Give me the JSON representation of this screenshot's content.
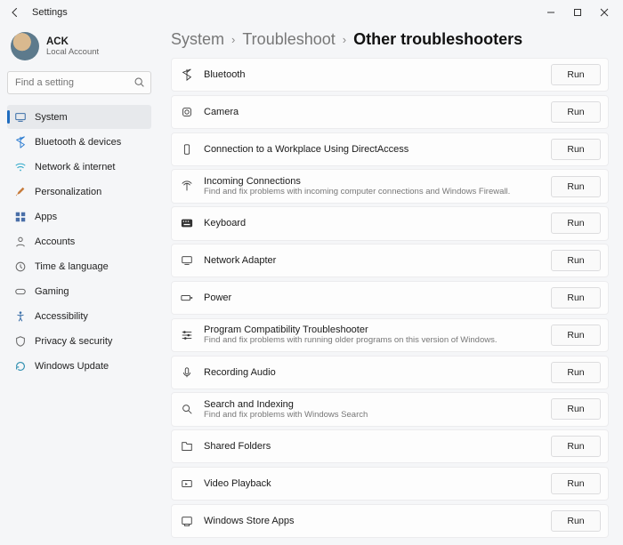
{
  "window": {
    "title": "Settings"
  },
  "user": {
    "name": "ACK",
    "sub": "Local Account"
  },
  "search": {
    "placeholder": "Find a setting"
  },
  "sidebar": {
    "items": [
      {
        "label": "System"
      },
      {
        "label": "Bluetooth & devices"
      },
      {
        "label": "Network & internet"
      },
      {
        "label": "Personalization"
      },
      {
        "label": "Apps"
      },
      {
        "label": "Accounts"
      },
      {
        "label": "Time & language"
      },
      {
        "label": "Gaming"
      },
      {
        "label": "Accessibility"
      },
      {
        "label": "Privacy & security"
      },
      {
        "label": "Windows Update"
      }
    ]
  },
  "breadcrumb": {
    "a": "System",
    "b": "Troubleshoot",
    "c": "Other troubleshooters"
  },
  "run_label": "Run",
  "items": [
    {
      "title": "Bluetooth",
      "sub": ""
    },
    {
      "title": "Camera",
      "sub": ""
    },
    {
      "title": "Connection to a Workplace Using DirectAccess",
      "sub": ""
    },
    {
      "title": "Incoming Connections",
      "sub": "Find and fix problems with incoming computer connections and Windows Firewall."
    },
    {
      "title": "Keyboard",
      "sub": ""
    },
    {
      "title": "Network Adapter",
      "sub": ""
    },
    {
      "title": "Power",
      "sub": ""
    },
    {
      "title": "Program Compatibility Troubleshooter",
      "sub": "Find and fix problems with running older programs on this version of Windows."
    },
    {
      "title": "Recording Audio",
      "sub": ""
    },
    {
      "title": "Search and Indexing",
      "sub": "Find and fix problems with Windows Search"
    },
    {
      "title": "Shared Folders",
      "sub": ""
    },
    {
      "title": "Video Playback",
      "sub": ""
    },
    {
      "title": "Windows Store Apps",
      "sub": ""
    }
  ]
}
